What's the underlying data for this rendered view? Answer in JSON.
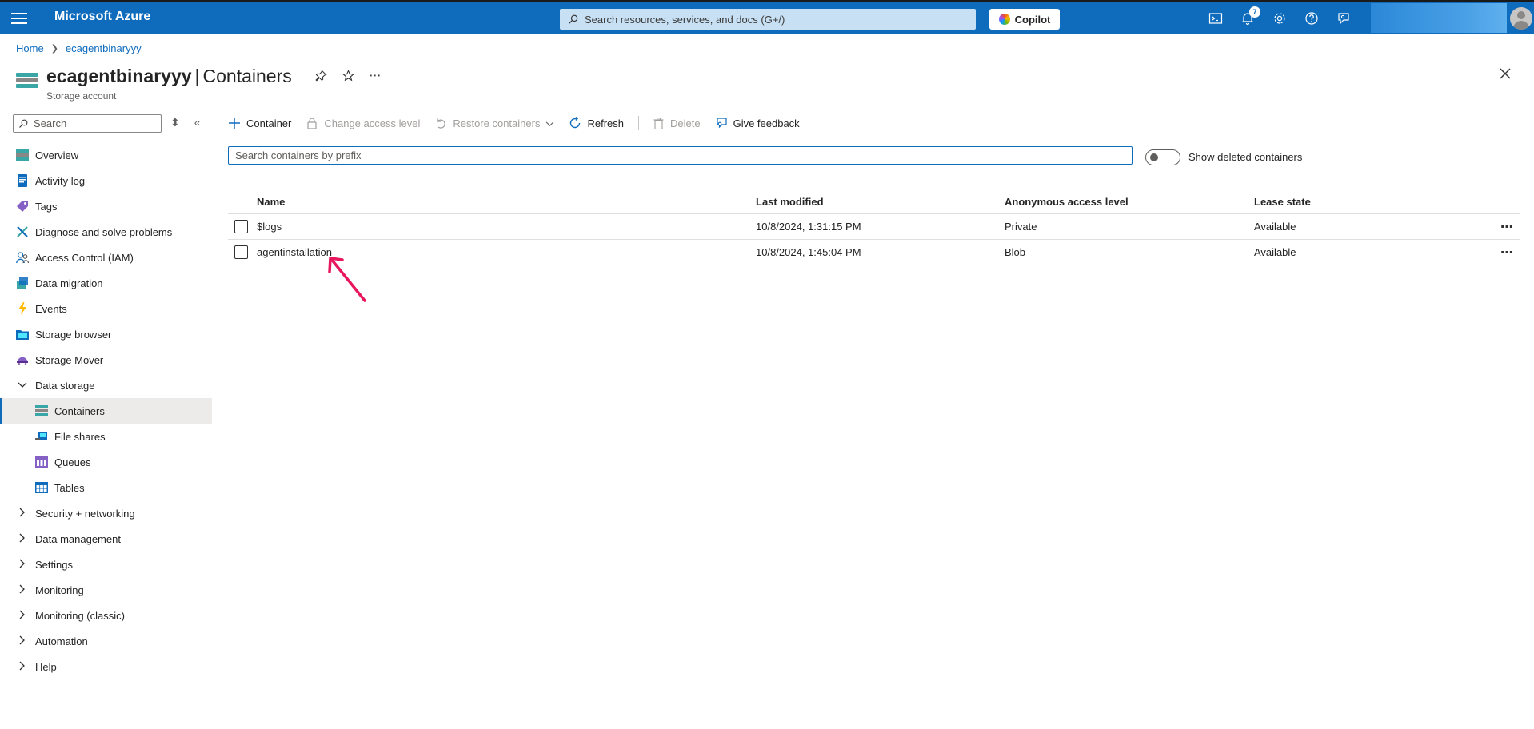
{
  "topbar": {
    "brand": "Microsoft Azure",
    "search_placeholder": "Search resources, services, and docs (G+/)",
    "copilot_label": "Copilot",
    "notification_count": "7"
  },
  "breadcrumb": {
    "home": "Home",
    "resource": "ecagentbinaryyy"
  },
  "header": {
    "resource_name": "ecagentbinaryyy",
    "separator": "|",
    "page_name": "Containers",
    "subtitle": "Storage account"
  },
  "sidebar": {
    "search_placeholder": "Search",
    "items": [
      {
        "label": "Overview",
        "icon": "overview-icon"
      },
      {
        "label": "Activity log",
        "icon": "activity-log-icon"
      },
      {
        "label": "Tags",
        "icon": "tag-icon"
      },
      {
        "label": "Diagnose and solve problems",
        "icon": "wrench-icon"
      },
      {
        "label": "Access Control (IAM)",
        "icon": "people-icon"
      },
      {
        "label": "Data migration",
        "icon": "migration-icon"
      },
      {
        "label": "Events",
        "icon": "lightning-icon"
      },
      {
        "label": "Storage browser",
        "icon": "folder-icon"
      },
      {
        "label": "Storage Mover",
        "icon": "mover-icon"
      },
      {
        "label": "Data storage",
        "expanded": true
      },
      {
        "label": "Containers",
        "icon": "containers-icon",
        "active": true
      },
      {
        "label": "File shares",
        "icon": "file-shares-icon"
      },
      {
        "label": "Queues",
        "icon": "queues-icon"
      },
      {
        "label": "Tables",
        "icon": "tables-icon"
      },
      {
        "label": "Security + networking"
      },
      {
        "label": "Data management"
      },
      {
        "label": "Settings"
      },
      {
        "label": "Monitoring"
      },
      {
        "label": "Monitoring (classic)"
      },
      {
        "label": "Automation"
      },
      {
        "label": "Help"
      }
    ]
  },
  "toolbar": {
    "add_container": "Container",
    "change_access": "Change access level",
    "restore": "Restore containers",
    "refresh": "Refresh",
    "delete": "Delete",
    "feedback": "Give feedback"
  },
  "filter": {
    "placeholder": "Search containers by prefix",
    "show_deleted_label": "Show deleted containers"
  },
  "table": {
    "columns": [
      "Name",
      "Last modified",
      "Anonymous access level",
      "Lease state"
    ],
    "rows": [
      {
        "name": "$logs",
        "modified": "10/8/2024, 1:31:15 PM",
        "access": "Private",
        "lease": "Available"
      },
      {
        "name": "agentinstallation",
        "modified": "10/8/2024, 1:45:04 PM",
        "access": "Blob",
        "lease": "Available"
      }
    ]
  },
  "colors": {
    "accent": "#0f6cbd",
    "annotation_arrow": "#e8175d"
  }
}
